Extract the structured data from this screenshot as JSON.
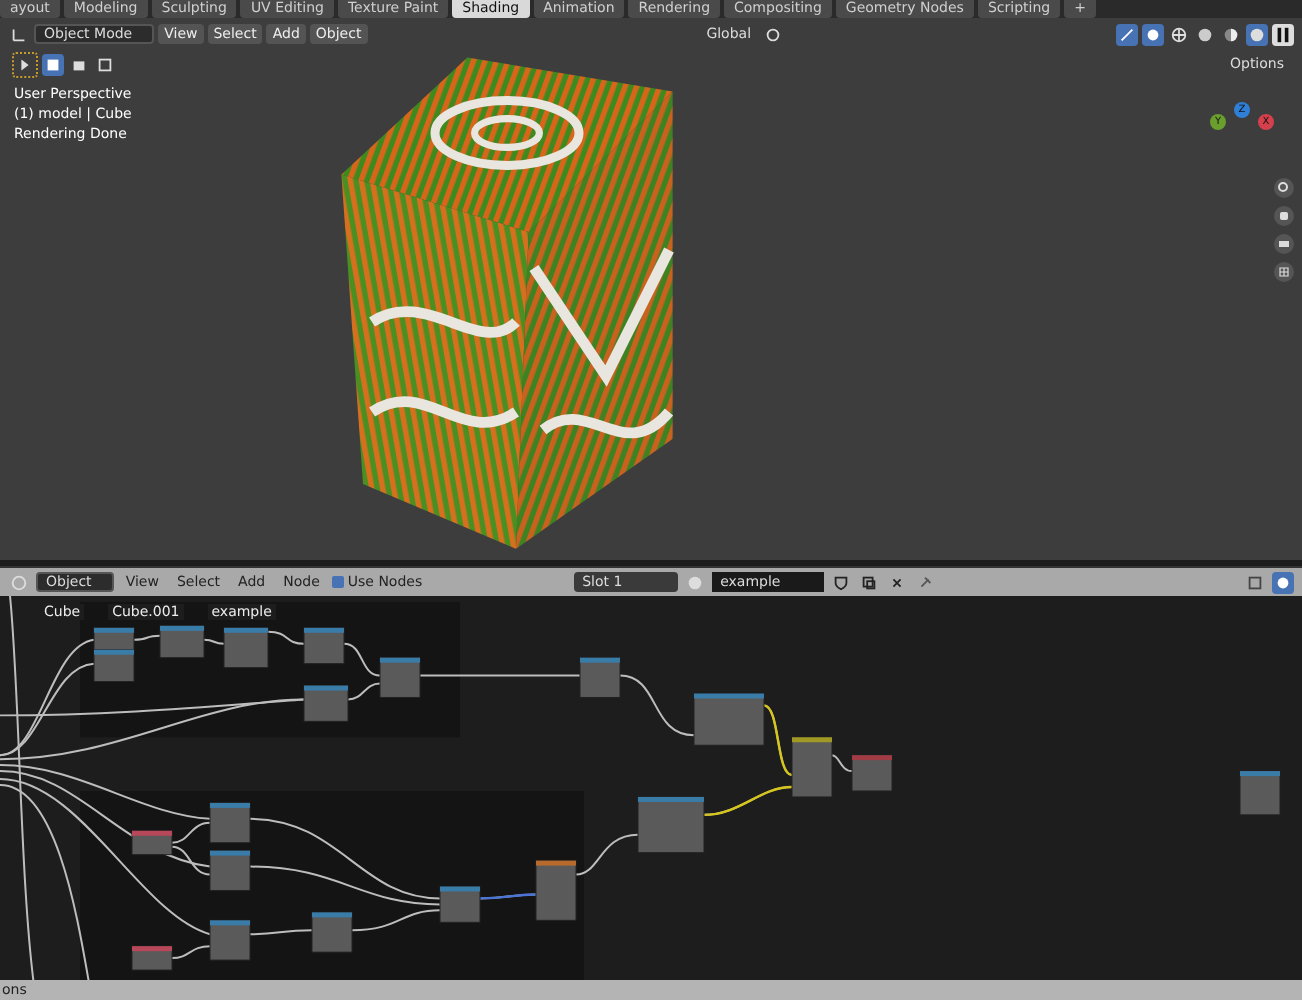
{
  "workspace_tabs": [
    {
      "label": "ayout",
      "selected": false
    },
    {
      "label": "Modeling",
      "selected": false
    },
    {
      "label": "Sculpting",
      "selected": false
    },
    {
      "label": "UV Editing",
      "selected": false
    },
    {
      "label": "Texture Paint",
      "selected": false
    },
    {
      "label": "Shading",
      "selected": true
    },
    {
      "label": "Animation",
      "selected": false
    },
    {
      "label": "Rendering",
      "selected": false
    },
    {
      "label": "Compositing",
      "selected": false
    },
    {
      "label": "Geometry Nodes",
      "selected": false
    },
    {
      "label": "Scripting",
      "selected": false
    },
    {
      "label": "+",
      "selected": false
    }
  ],
  "viewport": {
    "mode": "Object Mode",
    "menus": [
      "View",
      "Select",
      "Add",
      "Object"
    ],
    "orientation": "Global",
    "options": "Options",
    "overlay_lines": [
      "User Perspective",
      "(1) model | Cube",
      "Rendering Done"
    ],
    "gizmo_axes": [
      "Y",
      "Z",
      "X"
    ]
  },
  "node_editor": {
    "type": "Object",
    "menus": [
      "View",
      "Select",
      "Add",
      "Node"
    ],
    "use_nodes": {
      "label": "Use Nodes",
      "checked": true
    },
    "slot": "Slot 1",
    "material": "example",
    "breadcrumbs": [
      "Cube",
      "Cube.001",
      "example"
    ]
  },
  "status_bar": {
    "text": "ons"
  }
}
